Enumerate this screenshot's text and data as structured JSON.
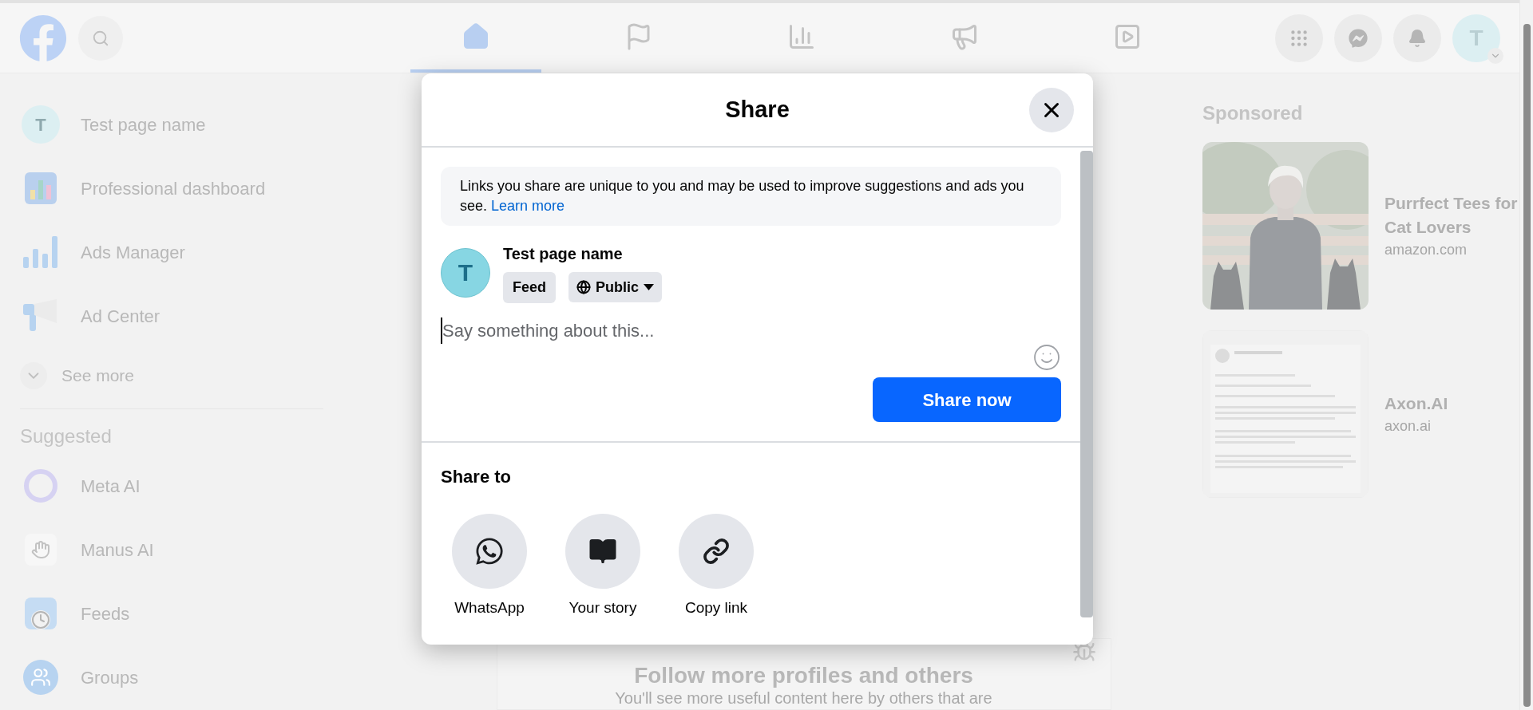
{
  "top_bar": {
    "nav_tabs": [
      {
        "kind": "home",
        "selected": true
      },
      {
        "kind": "flag",
        "selected": false
      },
      {
        "kind": "chart",
        "selected": false
      },
      {
        "kind": "megaphone",
        "selected": false
      },
      {
        "kind": "video",
        "selected": false
      }
    ],
    "actions": [
      {
        "kind": "menu"
      },
      {
        "kind": "messenger"
      },
      {
        "kind": "bell"
      }
    ],
    "avatar_initial": "T"
  },
  "sidebar": {
    "shortcuts": [
      {
        "kind": "avatar",
        "initial": "T",
        "label": "Test page name"
      },
      {
        "kind": "dashboard",
        "label": "Professional dashboard"
      },
      {
        "kind": "ads",
        "label": "Ads Manager"
      },
      {
        "kind": "adcenter",
        "label": "Ad Center"
      }
    ],
    "see_more": "See more",
    "suggested_title": "Suggested",
    "suggested": [
      {
        "kind": "meta",
        "label": "Meta AI"
      },
      {
        "kind": "manus",
        "label": "Manus AI"
      },
      {
        "kind": "feeds",
        "label": "Feeds"
      },
      {
        "kind": "groups",
        "label": "Groups"
      }
    ]
  },
  "feed": {
    "title": "Follow more profiles and others",
    "subtitle": "You'll see more useful content here by others that are"
  },
  "sponsored": {
    "title": "Sponsored",
    "ads": [
      {
        "kind": "picture",
        "title": "Purrfect Tees for Cat Lovers",
        "domain": "amazon.com"
      },
      {
        "kind": "picture",
        "title": "Axon.AI",
        "domain": "axon.ai"
      }
    ]
  },
  "share_dialog": {
    "title": "Share",
    "notice": "Links you share are unique to you and may be used to improve suggestions and ads you see.",
    "notice_link": "Learn more",
    "author": {
      "initial": "T",
      "name": "Test page name"
    },
    "destination": "Feed",
    "audience": "Public",
    "placeholder": "Say something about this...",
    "submit": "Share now",
    "share_to_title": "Share to",
    "targets": [
      {
        "kind": "whatsapp",
        "label": "WhatsApp"
      },
      {
        "kind": "story",
        "label": "Your story"
      },
      {
        "kind": "link",
        "label": "Copy link"
      }
    ]
  }
}
